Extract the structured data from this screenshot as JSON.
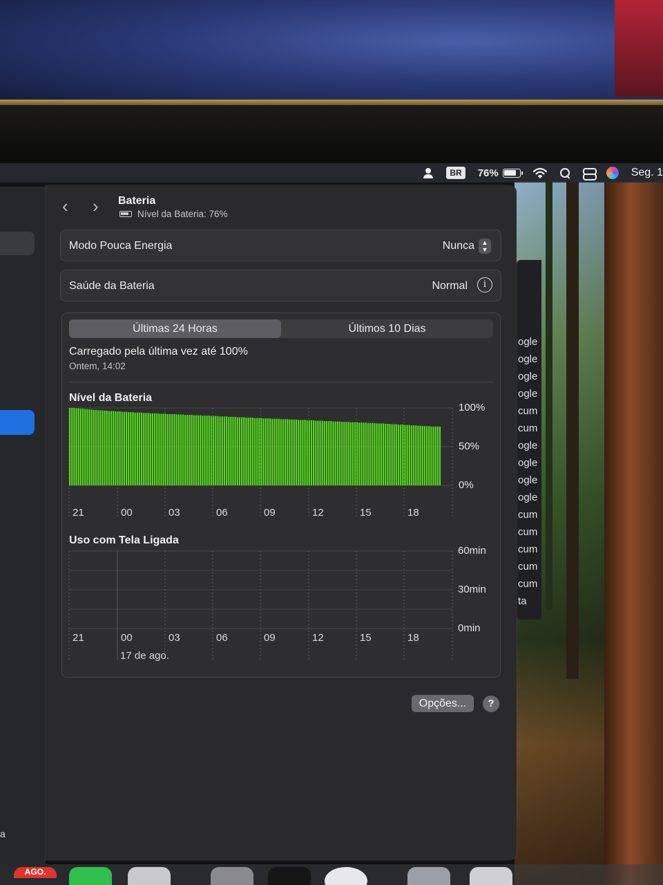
{
  "menubar": {
    "input_source": "BR",
    "battery_percent": "76%",
    "clock": "Seg. 1"
  },
  "header": {
    "title": "Bateria",
    "subtitle": "Nível da Bateria: 76%"
  },
  "low_power": {
    "label": "Modo Pouca Energia",
    "value": "Nunca"
  },
  "health": {
    "label": "Saúde da Bateria",
    "value": "Normal"
  },
  "tabs": [
    {
      "label": "Últimas 24 Horas",
      "active": true
    },
    {
      "label": "Últimos 10 Dias",
      "active": false
    }
  ],
  "last_charge": {
    "text": "Carregado pela última vez até 100%",
    "time": "Ontem, 14:02"
  },
  "battery_chart": {
    "title": "Nível da Bateria",
    "y_labels": [
      "100%",
      "50%",
      "0%"
    ],
    "x_labels": [
      "21",
      "00",
      "03",
      "06",
      "09",
      "12",
      "15",
      "18"
    ]
  },
  "screen_chart": {
    "title": "Uso com Tela Ligada",
    "y_labels": [
      "60min",
      "30min",
      "0min"
    ],
    "x_labels": [
      "21",
      "00",
      "03",
      "06",
      "09",
      "12",
      "15",
      "18"
    ],
    "date_label": "17 de ago."
  },
  "buttons": {
    "options": "Opções...",
    "help": "?"
  },
  "sidebar": {
    "fragment": "a"
  },
  "behind_window_items": [
    "ogle",
    "ogle",
    "ogle",
    "ogle",
    "cum",
    "cum",
    "ogle",
    "ogle",
    "ogle",
    "ogle",
    "cum",
    "cum",
    "cum",
    "cum",
    "cum",
    "ta"
  ],
  "dock": {
    "calendar_month": "AGO."
  },
  "colors": {
    "battery_bar": "#55d61f",
    "window_bg": "#2a2a2c",
    "accent": "#1f6fe0"
  },
  "chart_data": [
    {
      "type": "bar",
      "title": "Nível da Bateria",
      "xlabel": "",
      "ylabel": "",
      "ylim": [
        0,
        100
      ],
      "x_tick_labels": [
        "21",
        "00",
        "03",
        "06",
        "09",
        "12",
        "15",
        "18"
      ],
      "series": [
        {
          "values": [
            100,
            100,
            100,
            99.5,
            99.5,
            99,
            99,
            98.5,
            98.5,
            98,
            98,
            97.5,
            97.5,
            97,
            97,
            97,
            96.5,
            96.5,
            96,
            96,
            96,
            95.5,
            95.5,
            95.5,
            95,
            95,
            95,
            94.5,
            94.5,
            94.5,
            94,
            94,
            94,
            94,
            93.5,
            93.5,
            93.5,
            93,
            93,
            93,
            93,
            92.5,
            92.5,
            92.5,
            92.5,
            92,
            92,
            92,
            92,
            91.5,
            91.5,
            91.5,
            91.5,
            91,
            91,
            91,
            91,
            90.5,
            90.5,
            90.5,
            90.5,
            90,
            90,
            90,
            90,
            89.5,
            89.5,
            89.5,
            89.5,
            89,
            89,
            89,
            89,
            88.5,
            88.5,
            88.5,
            88.5,
            88,
            88,
            88,
            88,
            87.5,
            87.5,
            87.5,
            87.5,
            87,
            87,
            87,
            87,
            86.5,
            86.5,
            86.5,
            86.5,
            86,
            86,
            86,
            86,
            85.5,
            85.5,
            85.5,
            85.5,
            85,
            85,
            85,
            85,
            84.5,
            84.5,
            84.5,
            84.5,
            84,
            84,
            84,
            84,
            83.5,
            83.5,
            83.5,
            83.5,
            83,
            83,
            83,
            83,
            82.5,
            82.5,
            82.5,
            82.5,
            82,
            82,
            82,
            82,
            81.5,
            81.5,
            81.5,
            81.5,
            81,
            81,
            81,
            81,
            80.5,
            80.5,
            80.5,
            80.5,
            80,
            80,
            80,
            80,
            79.5,
            79.5,
            79.5,
            79,
            79,
            79,
            78.5,
            78.5,
            78.5,
            78,
            78,
            78,
            77.5,
            77.5,
            77.5,
            77,
            77,
            77,
            76.5,
            76.5,
            76.5,
            76,
            76,
            76,
            76,
            76
          ]
        }
      ]
    },
    {
      "type": "bar",
      "title": "Uso com Tela Ligada",
      "xlabel": "",
      "ylabel": "",
      "ylim": [
        0,
        60
      ],
      "x_tick_labels": [
        "21",
        "00",
        "03",
        "06",
        "09",
        "12",
        "15",
        "18"
      ],
      "series": [
        {
          "values": []
        }
      ]
    }
  ]
}
